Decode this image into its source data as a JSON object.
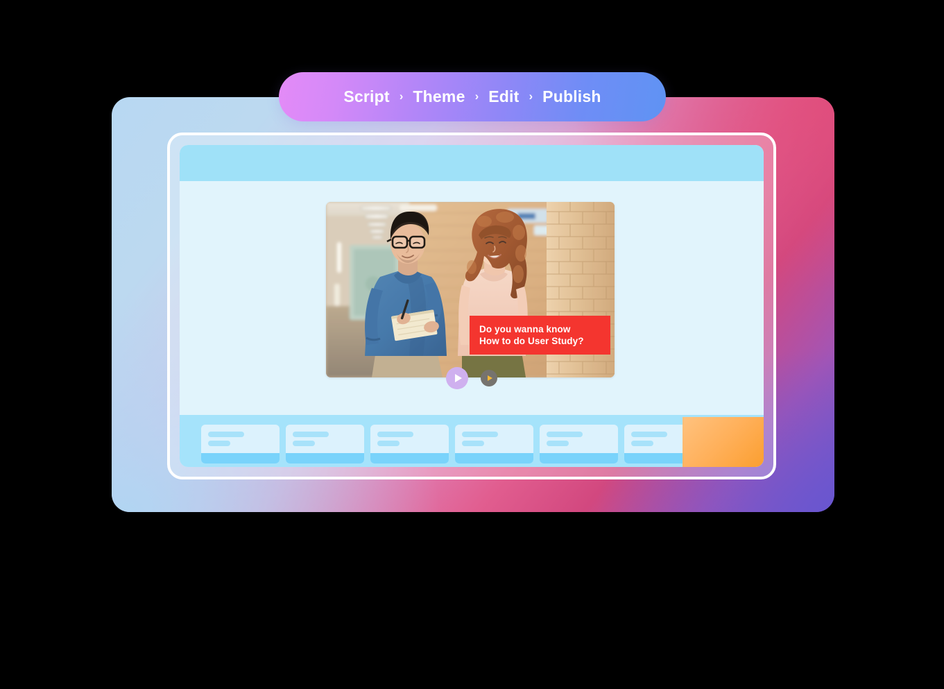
{
  "breadcrumb": {
    "separator": "›",
    "steps": [
      {
        "label": "Script",
        "active": false
      },
      {
        "label": "Theme",
        "active": false
      },
      {
        "label": "Edit",
        "active": true
      },
      {
        "label": "Publish",
        "active": false
      }
    ],
    "gradient_from": "#e48bf7",
    "gradient_to": "#5f93f3"
  },
  "outer_card": {
    "gradient_stops": [
      "#b8d8f2",
      "#d9a7d4",
      "#e15d8f",
      "#a355b5",
      "#6b57cf"
    ]
  },
  "editor": {
    "header": {
      "color": "#9fe1f8"
    },
    "canvas": {
      "background": "#e1f4fc"
    },
    "slide": {
      "alt": "Man in blue sweater writing on a notepad talking with a woman with curly auburn hair in an office hallway with brick walls",
      "caption": {
        "background": "#f4352f",
        "text_color": "#ffffff",
        "lines": [
          "Do you wanna know",
          "How to do User Study?"
        ]
      }
    },
    "playback": {
      "primary": {
        "icon": "play-icon",
        "color": "#cfb0ef",
        "glyph_color": "#ffffff"
      },
      "secondary": {
        "icon": "play-icon",
        "color": "#76736e",
        "glyph_color": "#f5b836"
      }
    },
    "timeline": {
      "background": "#a5e3fb",
      "card_count": 6,
      "card_body_color": "#dcf2fd",
      "card_footer_color": "#79d3fb",
      "placeholder_color": "#a8e2fa",
      "overlay_panel": {
        "name": "orange-panel",
        "color": "#fb9d2c"
      }
    }
  }
}
